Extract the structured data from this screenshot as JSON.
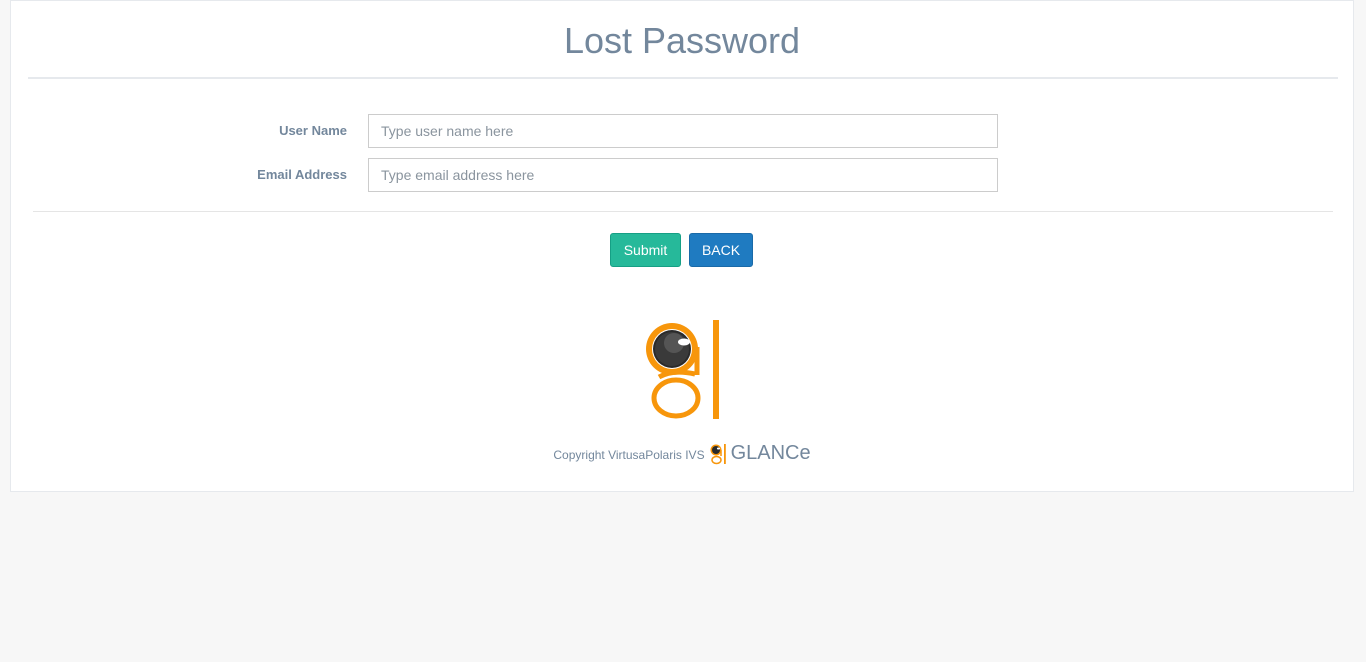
{
  "page": {
    "title": "Lost Password"
  },
  "form": {
    "username": {
      "label": "User Name",
      "value": "",
      "placeholder": "Type user name here"
    },
    "email": {
      "label": "Email Address",
      "value": "",
      "placeholder": "Type email address here"
    }
  },
  "actions": {
    "submit_label": "Submit",
    "back_label": "BACK"
  },
  "footer": {
    "copyright": "Copyright VirtusaPolaris IVS",
    "brand": "GLANCe"
  },
  "colors": {
    "accent_submit": "#26b99a",
    "accent_back": "#1f7bc1",
    "logo_orange": "#f7960b",
    "logo_dark": "#2a2a2a",
    "text": "#73879c"
  },
  "icons": {
    "main_logo": "glance-logo-icon",
    "footer_logo": "glance-small-logo-icon"
  }
}
